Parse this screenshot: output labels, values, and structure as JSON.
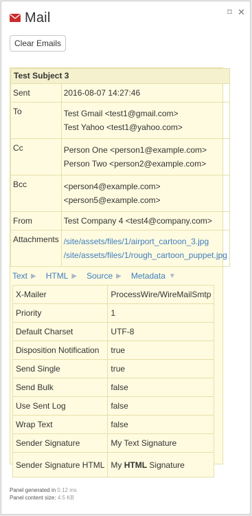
{
  "header": {
    "title": "Mail",
    "icon": "envelope-icon",
    "accent": "#cc2b2b"
  },
  "window": {
    "pin_glyph": "⌑",
    "close_glyph": "✕"
  },
  "toolbar": {
    "clear_label": "Clear Emails"
  },
  "email": {
    "subject": "Test Subject 3",
    "sent_label": "Sent",
    "sent_value": "2016-08-07 14:27:46",
    "to_label": "To",
    "to_values": [
      "Test Gmail <test1@gmail.com>",
      "Test Yahoo <test1@yahoo.com>"
    ],
    "cc_label": "Cc",
    "cc_values": [
      "Person One <person1@example.com>",
      "Person Two <person2@example.com>"
    ],
    "bcc_label": "Bcc",
    "bcc_values": [
      "<person4@example.com>",
      "<person5@example.com>"
    ],
    "from_label": "From",
    "from_value": "Test Company 4 <test4@company.com>",
    "attachments_label": "Attachments",
    "attachments": [
      "/site/assets/files/1/airport_cartoon_3.jpg",
      "/site/assets/files/1/rough_cartoon_puppet.jpg"
    ]
  },
  "tabs": [
    {
      "label": "Text",
      "arrow": "▶"
    },
    {
      "label": "HTML",
      "arrow": "▶"
    },
    {
      "label": "Source",
      "arrow": "▶"
    },
    {
      "label": "Metadata",
      "arrow": "▼"
    }
  ],
  "metadata": [
    {
      "key": "X-Mailer",
      "value": "ProcessWire/WireMailSmtp"
    },
    {
      "key": "Priority",
      "value": "1"
    },
    {
      "key": "Default Charset",
      "value": "UTF-8"
    },
    {
      "key": "Disposition Notification",
      "value": "true"
    },
    {
      "key": "Send Single",
      "value": "true"
    },
    {
      "key": "Send Bulk",
      "value": "false"
    },
    {
      "key": "Use Sent Log",
      "value": "false"
    },
    {
      "key": "Wrap Text",
      "value": "false"
    },
    {
      "key": "Sender Signature",
      "value": "My Text Signature"
    },
    {
      "key": "Sender Signature HTML",
      "value_pre": "My ",
      "value_bold": "HTML",
      "value_post": " Signature"
    }
  ],
  "footer": {
    "generated_label": "Panel generated in",
    "generated_value": "0.12 ms",
    "size_label": "Panel content size:",
    "size_value": "4.5 KB"
  }
}
